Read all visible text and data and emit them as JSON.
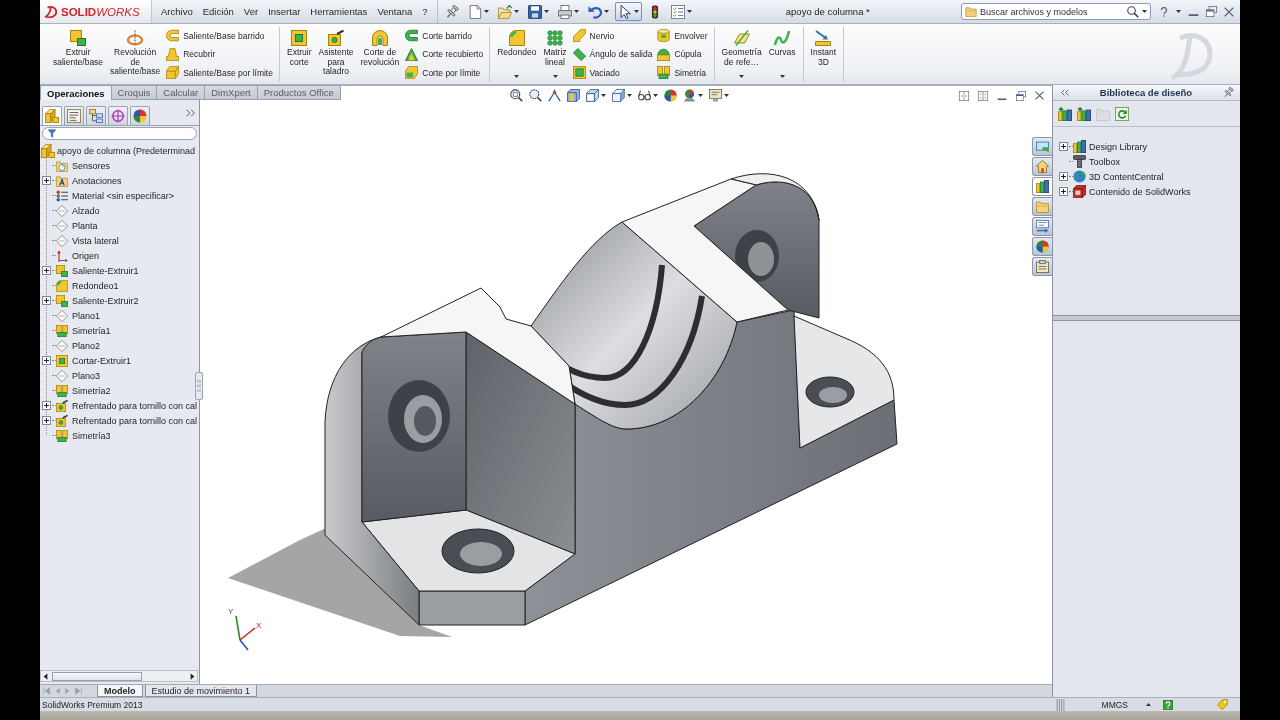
{
  "app": {
    "logo": "**SOLID**WORKS"
  },
  "menu": [
    "Archivo",
    "Edición",
    "Ver",
    "Insertar",
    "Herramientas",
    "Ventana",
    "?"
  ],
  "quick_access": [
    {
      "selected": false,
      "dropdown": false
    },
    {
      "selected": false,
      "dropdown": true
    },
    {
      "selected": false,
      "dropdown": true
    },
    {
      "selected": false,
      "dropdown": true
    },
    {
      "selected": false,
      "dropdown": true
    },
    {
      "selected": false,
      "dropdown": true
    },
    {
      "selected": true,
      "dropdown": true
    },
    {
      "selected": false,
      "dropdown": false
    },
    {
      "selected": false,
      "dropdown": true
    }
  ],
  "window": {
    "title": "apoyo de columna *"
  },
  "search": {
    "placeholder": "Buscar archivos y modelos"
  },
  "ribbon": {
    "groups": [
      {
        "items": [
          {
            "kind": "large",
            "label": "Extruir saliente/base",
            "dropdown": false
          },
          {
            "kind": "large",
            "label": "Revolución de saliente/base",
            "dropdown": false
          },
          {
            "kind": "stack",
            "entries": [
              "Saliente/Base barrido",
              "Recubrir",
              "Saliente/Base por límite"
            ]
          }
        ]
      },
      {
        "items": [
          {
            "kind": "large",
            "label": "Extruir corte",
            "dropdown": false
          },
          {
            "kind": "large",
            "label": "Asistente para taladro",
            "dropdown": false
          },
          {
            "kind": "large",
            "label": "Corte de revolución",
            "dropdown": false
          },
          {
            "kind": "stack",
            "entries": [
              "Corte barrido",
              "Corte recubierto",
              "Corte por límite"
            ]
          }
        ]
      },
      {
        "items": [
          {
            "kind": "large",
            "label": "Redondeo",
            "dropdown": true
          },
          {
            "kind": "large",
            "label": "Matriz lineal",
            "dropdown": true
          },
          {
            "kind": "stack",
            "entries": [
              "Nervio",
              "Ángulo de salida",
              "Vaciado"
            ]
          },
          {
            "kind": "stack",
            "entries": [
              "Envolver",
              "Cúpula",
              "Simetría"
            ]
          }
        ]
      },
      {
        "items": [
          {
            "kind": "large",
            "label": "Geometría de refe…",
            "dropdown": true
          },
          {
            "kind": "large",
            "label": "Curvas",
            "dropdown": true
          }
        ]
      },
      {
        "items": [
          {
            "kind": "large",
            "label": "Instant 3D",
            "dropdown": false
          }
        ]
      }
    ]
  },
  "command_tabs": [
    {
      "label": "Operaciones",
      "selected": true
    },
    {
      "label": "Croquis",
      "selected": false
    },
    {
      "label": "Calcular",
      "selected": false
    },
    {
      "label": "DimXpert",
      "selected": false
    },
    {
      "label": "Productos Office",
      "selected": false
    }
  ],
  "feature_manager": {
    "tabs": [
      {
        "kind": "features",
        "selected": true
      },
      {
        "kind": "properties",
        "selected": false
      },
      {
        "kind": "configurations",
        "selected": false
      },
      {
        "kind": "dimxpert",
        "selected": false
      },
      {
        "kind": "display",
        "selected": false
      }
    ],
    "tree": {
      "label": "apoyo de columna (Predeterminad",
      "children": [
        {
          "label": "Sensores",
          "kind": "sensors",
          "expandable": false
        },
        {
          "label": "Anotaciones",
          "kind": "annotations",
          "expandable": true
        },
        {
          "label": "Material <sin especificar>",
          "kind": "material",
          "expandable": false
        },
        {
          "label": "Alzado",
          "kind": "plane",
          "expandable": false
        },
        {
          "label": "Planta",
          "kind": "plane",
          "expandable": false
        },
        {
          "label": "Vista lateral",
          "kind": "plane",
          "expandable": false
        },
        {
          "label": "Origen",
          "kind": "origin",
          "expandable": false
        },
        {
          "label": "Saliente-Extruir1",
          "kind": "boss-extrude",
          "expandable": true
        },
        {
          "label": "Redondeo1",
          "kind": "fillet",
          "expandable": false
        },
        {
          "label": "Saliente-Extruir2",
          "kind": "boss-extrude",
          "expandable": true
        },
        {
          "label": "Plano1",
          "kind": "plane",
          "expandable": false
        },
        {
          "label": "Simetría1",
          "kind": "mirror",
          "expandable": false
        },
        {
          "label": "Plano2",
          "kind": "plane",
          "expandable": false
        },
        {
          "label": "Cortar-Extruir1",
          "kind": "cut-extrude",
          "expandable": true
        },
        {
          "label": "Plano3",
          "kind": "plane",
          "expandable": false
        },
        {
          "label": "Simetría2",
          "kind": "mirror",
          "expandable": false
        },
        {
          "label": "Refrentado para tornillo con cal",
          "kind": "hole",
          "expandable": true
        },
        {
          "label": "Refrentado para tornillo con cal",
          "kind": "hole",
          "expandable": true
        },
        {
          "label": "Simetría3",
          "kind": "mirror",
          "expandable": false
        }
      ]
    }
  },
  "viewport": {
    "view_toolbar": [
      {
        "dropdown": false
      },
      {
        "dropdown": false
      },
      {
        "dropdown": false
      },
      {
        "dropdown": false
      },
      {
        "dropdown": true
      },
      {
        "dropdown": true
      },
      {
        "dropdown": true
      },
      {
        "dropdown": false
      },
      {
        "dropdown": true
      },
      {
        "dropdown": true
      }
    ],
    "task_pane_tabs": [
      {
        "selected": false
      },
      {
        "selected": false
      },
      {
        "selected": true
      },
      {
        "selected": false
      },
      {
        "selected": false
      },
      {
        "selected": false
      },
      {
        "selected": false
      }
    ],
    "triad": {
      "labels": [
        "Y",
        "X"
      ]
    }
  },
  "design_library": {
    "title": "Biblioteca de diseño",
    "toolbar": [
      {
        "disabled": false
      },
      {
        "disabled": false
      },
      {
        "disabled": true
      },
      {
        "disabled": false
      }
    ],
    "tree": [
      {
        "label": "Design Library",
        "kind": "library",
        "expandable": true
      },
      {
        "label": "Toolbox",
        "kind": "toolbox",
        "expandable": false
      },
      {
        "label": "3D ContentCentral",
        "kind": "globe",
        "expandable": true
      },
      {
        "label": "Contenido de SolidWorks",
        "kind": "sw-content",
        "expandable": true
      }
    ]
  },
  "bottom_tabs": [
    {
      "label": "Modelo",
      "selected": true
    },
    {
      "label": "Estudio de movimiento 1",
      "selected": false
    }
  ],
  "status_bar": {
    "product": "SolidWorks Premium 2013",
    "units": "MMGS"
  }
}
